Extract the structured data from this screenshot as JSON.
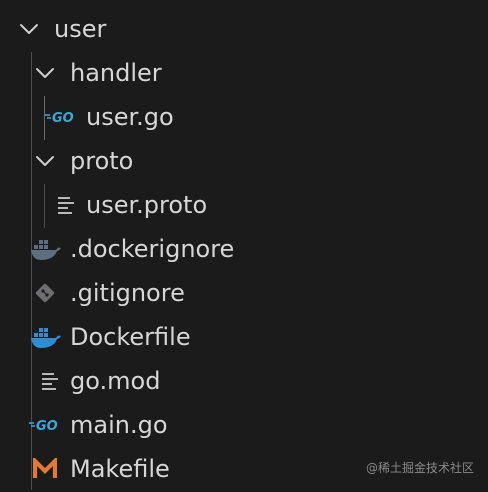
{
  "explorer": {
    "root": {
      "label": "user",
      "icon": "chevron-down-icon"
    },
    "items": [
      {
        "label": "handler",
        "icon": "chevron-down-icon"
      },
      {
        "label": "user.go",
        "icon": "go-file-icon"
      },
      {
        "label": "proto",
        "icon": "chevron-down-icon"
      },
      {
        "label": "user.proto",
        "icon": "text-file-icon"
      },
      {
        "label": ".dockerignore",
        "icon": "docker-icon"
      },
      {
        "label": ".gitignore",
        "icon": "git-icon"
      },
      {
        "label": "Dockerfile",
        "icon": "docker-icon"
      },
      {
        "label": "go.mod",
        "icon": "text-file-icon"
      },
      {
        "label": "main.go",
        "icon": "go-file-icon"
      },
      {
        "label": "Makefile",
        "icon": "makefile-icon"
      }
    ]
  },
  "watermark": "@稀土掘金技术社区",
  "colors": {
    "background": "#1b1b1c",
    "text": "#d6d6d6",
    "go": "#3aa7d6",
    "docker_dim": "#5c6e80",
    "docker": "#2f8ed2",
    "makefile": "#e37933",
    "git": "#6e6e70"
  }
}
